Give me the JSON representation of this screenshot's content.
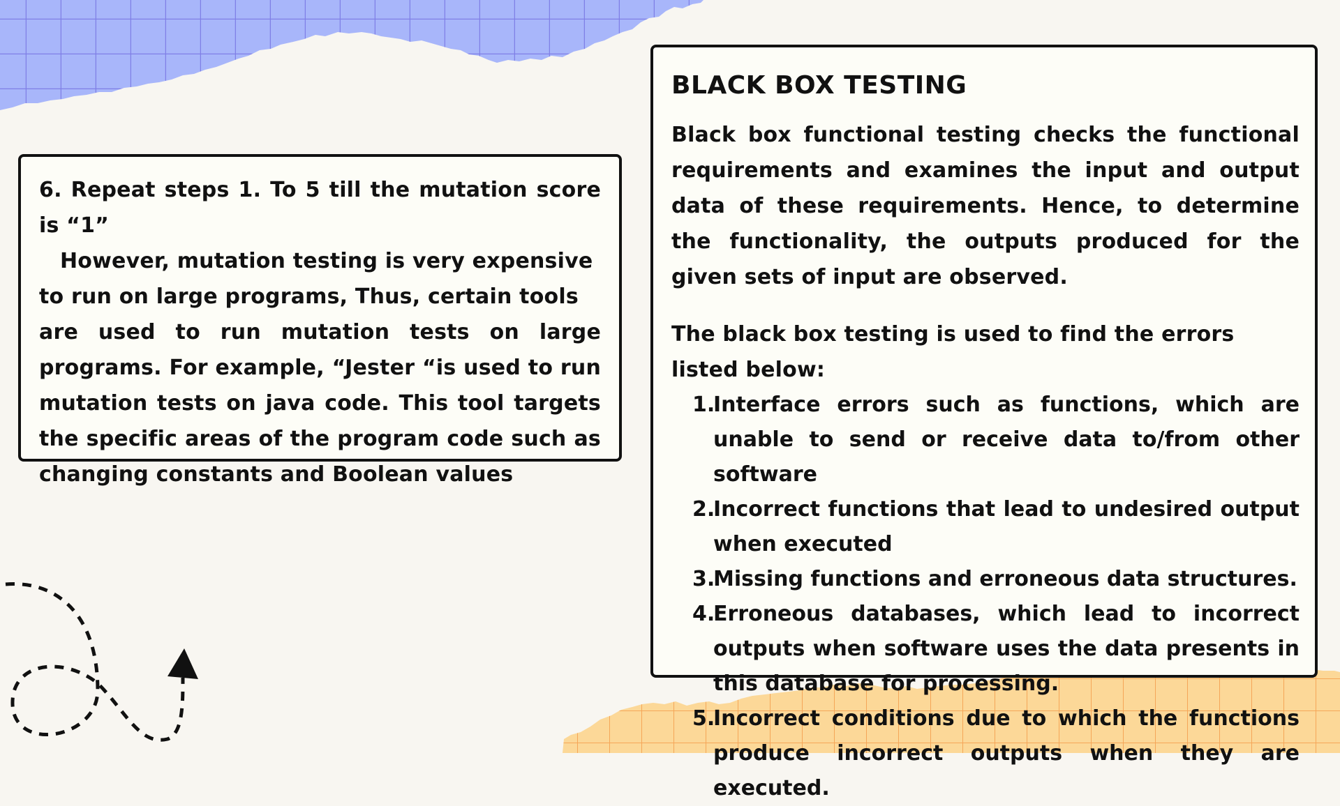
{
  "left_box": {
    "line1": "6. Repeat steps 1. To 5 till the mutation score is “1”",
    "line2": "However, mutation testing is very expensive to run on large programs, Thus, certain tools",
    "line3": "are used to run mutation tests on large programs. For example, “Jester “is used to run mutation tests on java code. This tool targets the specific areas of the program code such as changing constants and Boolean values"
  },
  "right_box": {
    "title": "BLACK BOX TESTING",
    "intro": "Black box functional testing checks the functional requirements and examines the input and output data of these requirements. Hence, to determine the functionality, the outputs produced for the given sets of input are observed.",
    "list_heading": "The black box testing is used to find the errors listed below:",
    "items": [
      {
        "num": "1.",
        "text": "Interface errors such as functions, which are unable to send or receive data to/from other software"
      },
      {
        "num": "2.",
        "text": "Incorrect functions that lead to undesired output when executed"
      },
      {
        "num": "3.",
        "text": "Missing functions and erroneous data structures."
      },
      {
        "num": "4.",
        "text": "Erroneous databases, which lead to incorrect outputs when software uses the data presents in this database for processing."
      },
      {
        "num": "5.",
        "text": "Incorrect conditions due to which the functions produce incorrect outputs when they are executed."
      }
    ]
  },
  "colors": {
    "background": "#f8f6f1",
    "grid_paper_blue": "#a8b6fa",
    "grid_line_blue": "#7f7fe6",
    "grid_paper_orange": "#fcd898",
    "grid_line_orange": "#f5a658",
    "card_border": "#111111"
  },
  "decorations": [
    "blue-grid-paper-torn",
    "orange-grid-paper-torn",
    "dashed-loop-arrow-icon"
  ]
}
